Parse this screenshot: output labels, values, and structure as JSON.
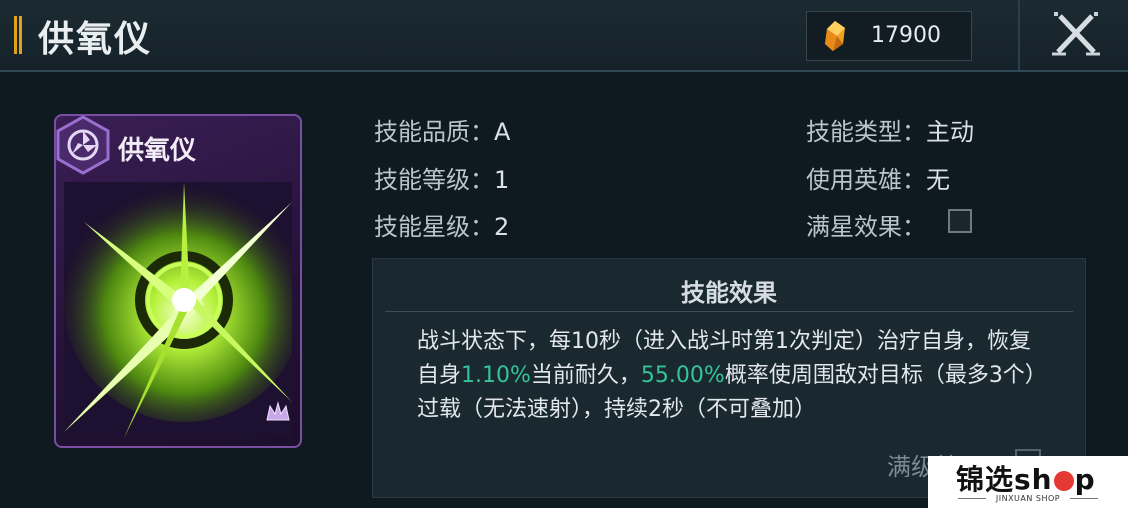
{
  "header": {
    "title": "供氧仪",
    "currency": {
      "icon": "crystal-icon",
      "amount": "17900"
    },
    "close_icon": "close-icon"
  },
  "card": {
    "title": "供氧仪",
    "type_icon": "hex-emblem-icon",
    "rank_icon": "crown-icon"
  },
  "info": {
    "quality_label": "技能品质：",
    "quality_value": "A",
    "level_label": "技能等级：",
    "level_value": "1",
    "star_label": "技能星级：",
    "star_value": "2",
    "type_label": "技能类型：",
    "type_value": "主动",
    "hero_label": "使用英雄：",
    "hero_value": "无",
    "full_star_label": "满星效果："
  },
  "effect": {
    "title": "技能效果",
    "text_1": "战斗状态下，每10秒（进入战斗时第1次判定）治疗自身，恢复自身",
    "highlight_1": "1.10%",
    "text_2": "当前耐久，",
    "highlight_2": "55.00%",
    "text_3": "概率使周围敌对目标（最多3个）过载（无法速射），持续2秒（不可叠加）",
    "full_level_label": "满级效果："
  },
  "watermark": {
    "text_pre": "锦选sh",
    "text_post": "p",
    "sub": "JINXUAN SHOP"
  },
  "colors": {
    "highlight": "#34c39a",
    "accent_gold": "#e0a21c",
    "card_purple": "#7a4ea4"
  }
}
